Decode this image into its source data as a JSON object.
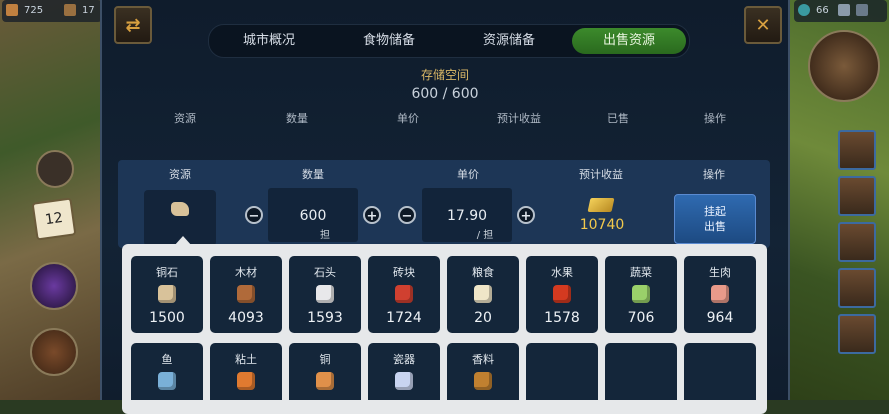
{
  "top_bar": {
    "left_stat_1": "725",
    "left_stat_2": "17",
    "right_stat": "66"
  },
  "tabs": [
    {
      "label": "城市概况",
      "active": false
    },
    {
      "label": "食物储备",
      "active": false
    },
    {
      "label": "资源储备",
      "active": false
    },
    {
      "label": "出售资源",
      "active": true
    }
  ],
  "storage": {
    "label": "存储空间",
    "value": "600 / 600"
  },
  "headers": [
    "资源",
    "数量",
    "单价",
    "预计收益",
    "已售",
    "操作"
  ],
  "sell_row": {
    "headers": [
      "资源",
      "数量",
      "单价",
      "预计收益",
      "操作"
    ],
    "quantity": "600",
    "quantity_unit": "担",
    "price": "17.90",
    "price_unit": "/ 担",
    "income": "10740",
    "sell_button_line1": "挂起",
    "sell_button_line2": "出售",
    "minus": "−",
    "plus": "+"
  },
  "resources": [
    {
      "name": "铜石",
      "qty": "1500",
      "icon": "copper-ore-icon",
      "color": "#d8c29a"
    },
    {
      "name": "木材",
      "qty": "4093",
      "icon": "wood-icon",
      "color": "#b06a3a"
    },
    {
      "name": "石头",
      "qty": "1593",
      "icon": "stone-icon",
      "color": "#e8e8ea"
    },
    {
      "name": "砖块",
      "qty": "1724",
      "icon": "brick-icon",
      "color": "#d04030"
    },
    {
      "name": "粮食",
      "qty": "20",
      "icon": "grain-icon",
      "color": "#efe6c8"
    },
    {
      "name": "水果",
      "qty": "1578",
      "icon": "fruit-icon",
      "color": "#d43a20"
    },
    {
      "name": "蔬菜",
      "qty": "706",
      "icon": "vegetable-icon",
      "color": "#9ad06a"
    },
    {
      "name": "生肉",
      "qty": "964",
      "icon": "meat-icon",
      "color": "#e89a8a"
    },
    {
      "name": "鱼",
      "qty": "",
      "icon": "fish-icon",
      "color": "#7ab0d8"
    },
    {
      "name": "粘土",
      "qty": "",
      "icon": "clay-icon",
      "color": "#e07a30"
    },
    {
      "name": "铜",
      "qty": "",
      "icon": "copper-ingot-icon",
      "color": "#e0904a"
    },
    {
      "name": "瓷器",
      "qty": "",
      "icon": "porcelain-icon",
      "color": "#c8d4f0"
    },
    {
      "name": "香料",
      "qty": "",
      "icon": "spice-icon",
      "color": "#c08030"
    },
    {
      "name": "",
      "qty": "",
      "icon": "",
      "color": ""
    },
    {
      "name": "",
      "qty": "",
      "icon": "",
      "color": ""
    },
    {
      "name": "",
      "qty": "",
      "icon": "",
      "color": ""
    }
  ],
  "left_badge": "12"
}
